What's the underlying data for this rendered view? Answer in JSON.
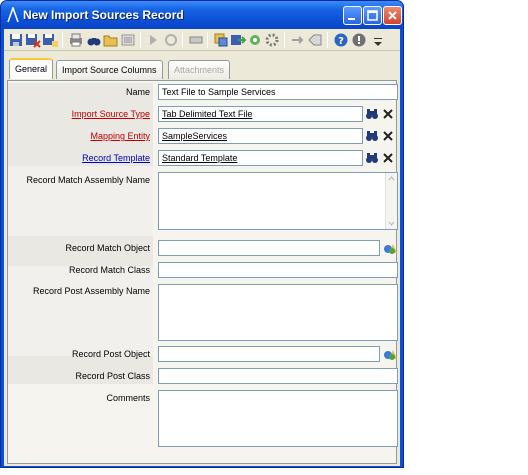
{
  "window": {
    "title": "New Import Sources Record"
  },
  "tabs": [
    {
      "label": "General",
      "state": "active"
    },
    {
      "label": "Import Source Columns",
      "state": "normal"
    },
    {
      "label": "Attachments",
      "state": "disabled"
    }
  ],
  "form": {
    "name": {
      "label": "Name",
      "value": "Text File to Sample Services"
    },
    "import_source_type": {
      "label": "Import Source Type",
      "value": "Tab Delimited Text File"
    },
    "mapping_entity": {
      "label": "Mapping Entity",
      "value": "SampleServices"
    },
    "record_template": {
      "label": "Record Template",
      "value": "Standard Template"
    },
    "record_match_assembly_name": {
      "label": "Record Match Assembly Name",
      "value": ""
    },
    "record_match_object": {
      "label": "Record Match Object",
      "value": ""
    },
    "record_match_class": {
      "label": "Record Match Class",
      "value": ""
    },
    "record_post_assembly_name": {
      "label": "Record Post Assembly Name",
      "value": ""
    },
    "record_post_object": {
      "label": "Record Post Object",
      "value": ""
    },
    "record_post_class": {
      "label": "Record Post Class",
      "value": ""
    },
    "comments": {
      "label": "Comments",
      "value": ""
    }
  },
  "colors": {
    "required_label": "#c00000",
    "link_label": "#0000c0",
    "titlebar": "#0a4fd8"
  }
}
